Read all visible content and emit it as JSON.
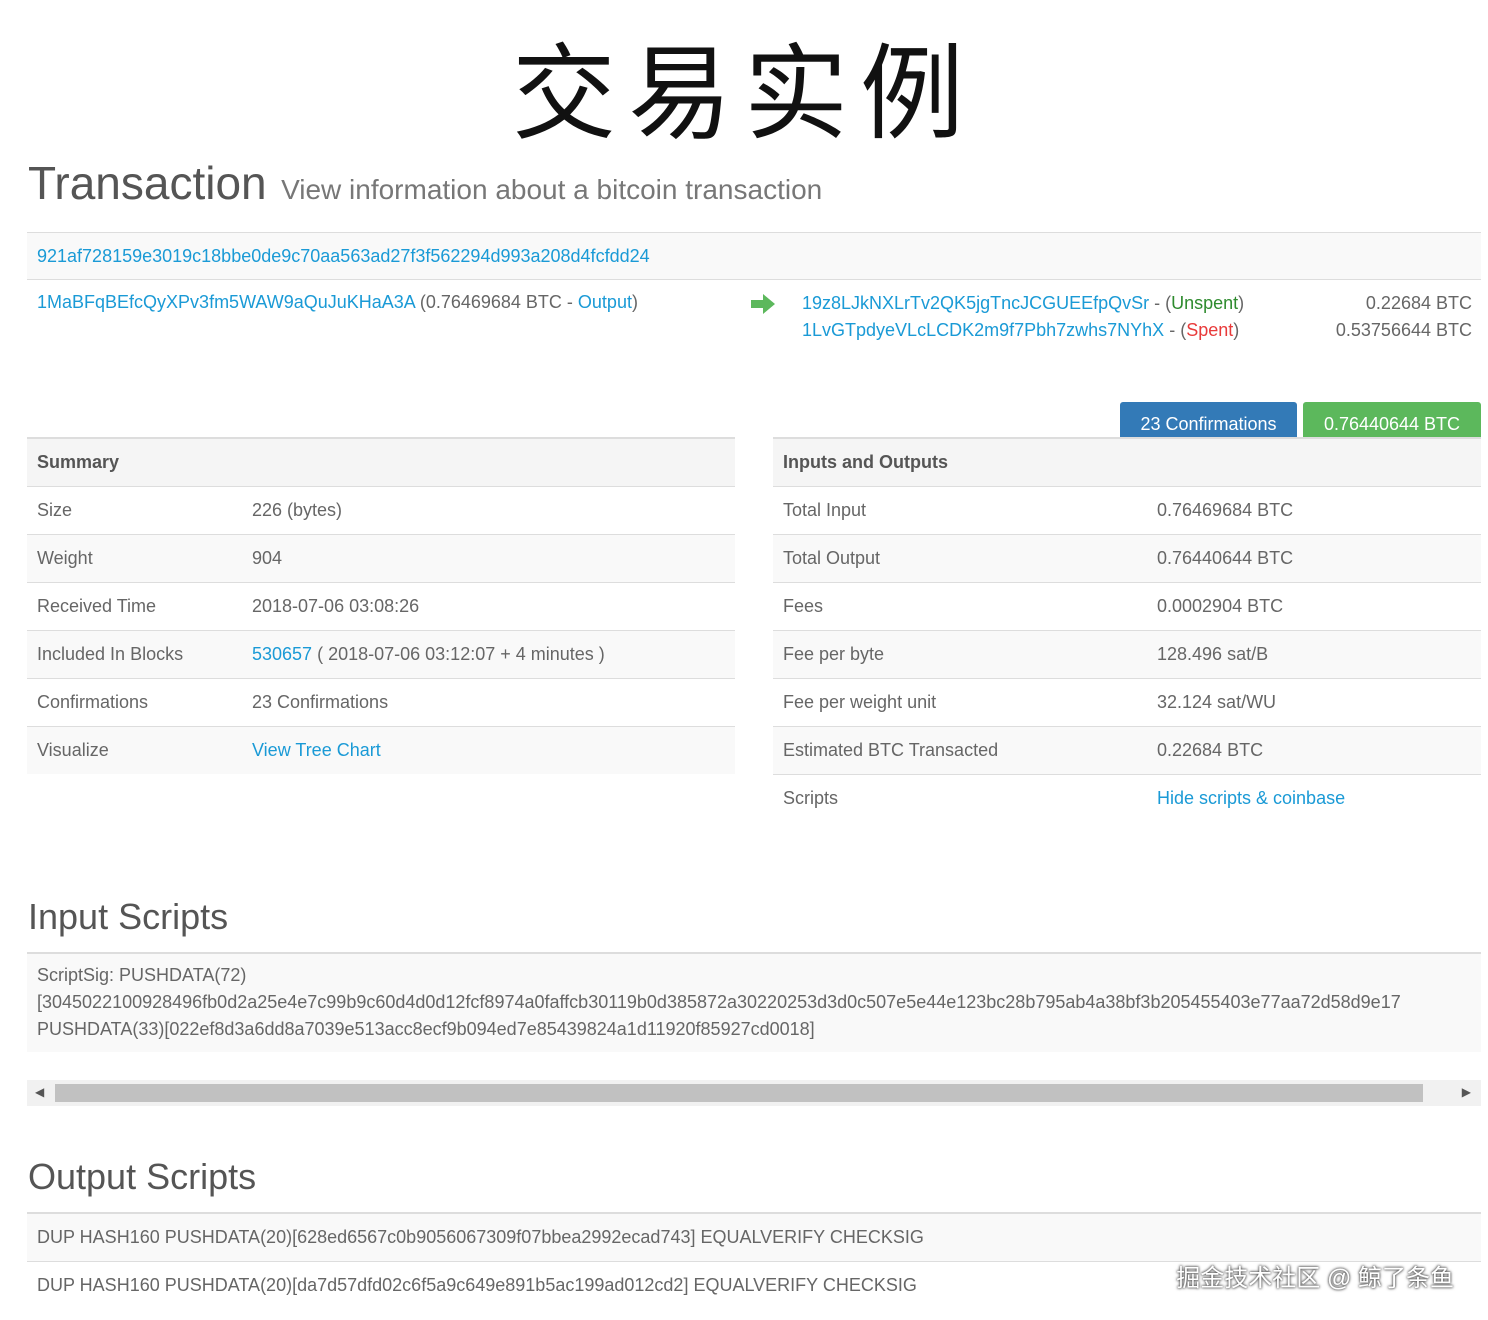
{
  "banner": "交易实例",
  "header": {
    "title": "Transaction",
    "subtitle": "View information about a bitcoin transaction"
  },
  "tx": {
    "hash": "921af728159e3019c18bbe0de9c70aa563ad27f3f562294d993a208d4fcfdd24",
    "input": {
      "address": "1MaBFqBEfcQyXPv3fm5WAW9aQuJuKHaA3A",
      "amount_prefix": "(0.76469684 BTC - ",
      "output_link": "Output",
      "suffix": ")"
    },
    "outputs": [
      {
        "address": "19z8LJkNXLrTv2QK5jgTncJCGUEEfpQvSr",
        "sep": " - (",
        "status": "Unspent",
        "close": ")",
        "amount": "0.22684 BTC"
      },
      {
        "address": "1LvGTpdyeVLcLCDK2m9f7Pbh7zwhs7NYhX",
        "sep": " - (",
        "status": "Spent",
        "close": ")",
        "amount": "0.53756644 BTC"
      }
    ],
    "confirmations_badge": "23 Confirmations",
    "total_badge": "0.76440644 BTC"
  },
  "summary": {
    "heading": "Summary",
    "size_label": "Size",
    "size_value": "226 (bytes)",
    "weight_label": "Weight",
    "weight_value": "904",
    "received_label": "Received Time",
    "received_value": "2018-07-06 03:08:26",
    "blocks_label": "Included In Blocks",
    "block_link": "530657",
    "block_detail": "( 2018-07-06 03:12:07 + 4 minutes )",
    "confirmations_label": "Confirmations",
    "confirmations_value": "23 Confirmations",
    "visualize_label": "Visualize",
    "visualize_link": "View Tree Chart"
  },
  "io": {
    "heading": "Inputs and Outputs",
    "total_input_label": "Total Input",
    "total_input_value": "0.76469684 BTC",
    "total_output_label": "Total Output",
    "total_output_value": "0.76440644 BTC",
    "fees_label": "Fees",
    "fees_value": "0.0002904 BTC",
    "fee_byte_label": "Fee per byte",
    "fee_byte_value": "128.496 sat/B",
    "fee_wu_label": "Fee per weight unit",
    "fee_wu_value": "32.124 sat/WU",
    "estimated_label": "Estimated BTC Transacted",
    "estimated_value": "0.22684 BTC",
    "scripts_label": "Scripts",
    "scripts_link": "Hide scripts & coinbase"
  },
  "input_scripts": {
    "title": "Input Scripts",
    "line1": "ScriptSig: PUSHDATA(72)",
    "line2": "[3045022100928496fb0d2a25e4e7c99b9c60d4d0d12fcf8974a0faffcb30119b0d385872a30220253d3d0c507e5e44e123bc28b795ab4a38bf3b205455403e77aa72d58d9e17",
    "line3": "PUSHDATA(33)[022ef8d3a6dd8a7039e513acc8ecf9b094ed7e85439824a1d11920f85927cd0018]"
  },
  "output_scripts": {
    "title": "Output Scripts",
    "rows": [
      "DUP HASH160 PUSHDATA(20)[628ed6567c0b9056067309f07bbea2992ecad743] EQUALVERIFY CHECKSIG",
      "DUP HASH160 PUSHDATA(20)[da7d57dfd02c6f5a9c649e891b5ac199ad012cd2] EQUALVERIFY CHECKSIG"
    ]
  },
  "watermark": "掘金技术社区 @ 鲸了条鱼",
  "colors": {
    "link": "#1a9ad6",
    "confirm_badge": "#337ab7",
    "btc_badge": "#5cb85c",
    "unspent": "#2e8b2e",
    "spent": "#e83a3a",
    "arrow": "#5cb85c"
  },
  "icons": {
    "arrow": "arrow-right-icon",
    "scroll_left": "scroll-left-icon",
    "scroll_right": "scroll-right-icon"
  }
}
